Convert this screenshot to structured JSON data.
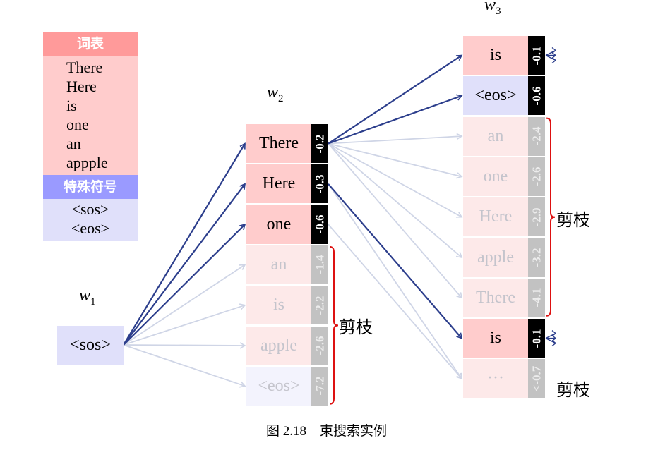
{
  "vocab": {
    "title": "词表",
    "words": [
      "There",
      "Here",
      "is",
      "one",
      "an",
      "appple"
    ],
    "special_title": "特殊符号",
    "special": [
      "<sos>",
      "<eos>"
    ]
  },
  "labels": {
    "w1": "w",
    "w1_sub": "1",
    "w2": "w",
    "w2_sub": "2",
    "w3": "w",
    "w3_sub": "3",
    "prune": "剪枝"
  },
  "start": {
    "word": "<sos>"
  },
  "layer2": [
    {
      "word": "There",
      "score": "-0.2",
      "state": "kept"
    },
    {
      "word": "Here",
      "score": "-0.3",
      "state": "kept"
    },
    {
      "word": "one",
      "score": "-0.6",
      "state": "kept"
    },
    {
      "word": "an",
      "score": "-1.4",
      "state": "pruned"
    },
    {
      "word": "is",
      "score": "-2.2",
      "state": "pruned"
    },
    {
      "word": "apple",
      "score": "-2.6",
      "state": "pruned"
    },
    {
      "word": "<eos>",
      "score": "-7.2",
      "state": "pruned-eos"
    }
  ],
  "layer3": [
    {
      "word": "is",
      "score": "-0.1",
      "state": "kept"
    },
    {
      "word": "<eos>",
      "score": "-0.6",
      "state": "eos"
    },
    {
      "word": "an",
      "score": "-2.4",
      "state": "pruned"
    },
    {
      "word": "one",
      "score": "-2.6",
      "state": "pruned"
    },
    {
      "word": "Here",
      "score": "-2.9",
      "state": "pruned"
    },
    {
      "word": "apple",
      "score": "-3.2",
      "state": "pruned"
    },
    {
      "word": "There",
      "score": "-4.1",
      "state": "pruned"
    },
    {
      "word": "is",
      "score": "-0.1",
      "state": "kept"
    },
    {
      "word": "···",
      "score": "<-0.7",
      "state": "pruned"
    }
  ],
  "caption": "图 2.18　束搜索实例",
  "colors": {
    "kept_fill": "#ffcccc",
    "pruned_fill": "#fde9e9",
    "eos_fill": "#e0e0fa",
    "eos_pruned_fill": "#f3f3fd",
    "arrow_active": "#2c3e8c",
    "arrow_inactive": "#cfd5e6",
    "brace": "#dd1111"
  }
}
